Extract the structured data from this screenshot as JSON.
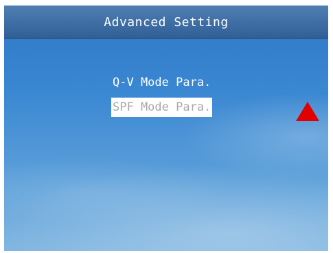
{
  "header": {
    "title": "Advanced Setting"
  },
  "menu": {
    "items": [
      {
        "label": "Q-V Mode Para.",
        "selected": false
      },
      {
        "label": "SPF Mode Para.",
        "selected": true
      }
    ]
  },
  "indicator": {
    "icon": "up-arrow-icon",
    "color": "#e00000"
  }
}
